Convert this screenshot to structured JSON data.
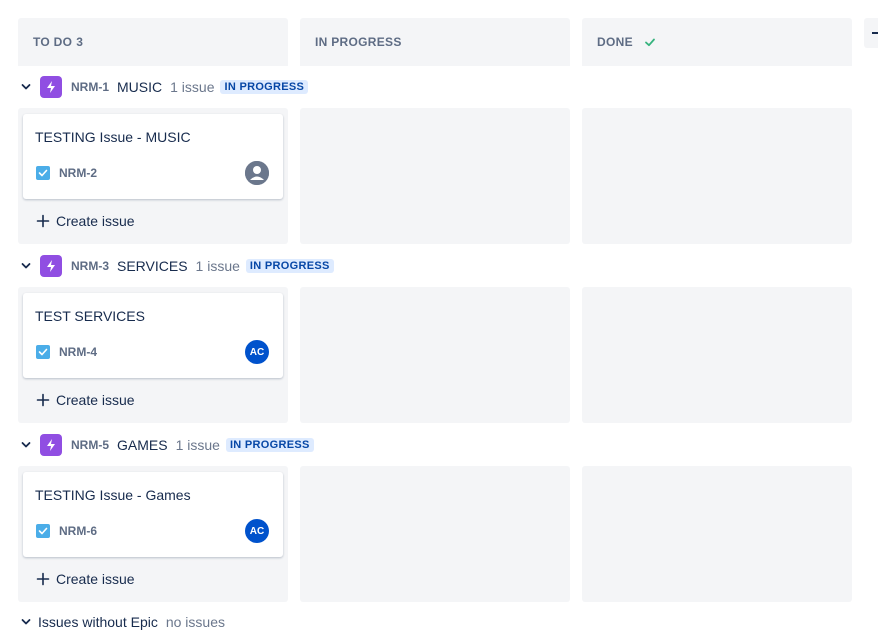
{
  "columns": [
    {
      "label": "TO DO",
      "count": "3"
    },
    {
      "label": "IN PROGRESS",
      "count": ""
    },
    {
      "label": "DONE",
      "count": ""
    }
  ],
  "epics": [
    {
      "key": "NRM-1",
      "name": "MUSIC",
      "issue_count": "1 issue",
      "status": "IN PROGRESS",
      "card": {
        "title": "TESTING Issue - MUSIC",
        "key": "NRM-2",
        "assignee": "",
        "assignee_type": "default-avatar-icon"
      },
      "create_label": "Create issue"
    },
    {
      "key": "NRM-3",
      "name": "SERVICES",
      "issue_count": "1 issue",
      "status": "IN PROGRESS",
      "card": {
        "title": "TEST SERVICES",
        "key": "NRM-4",
        "assignee": "AC",
        "assignee_type": "initials"
      },
      "create_label": "Create issue"
    },
    {
      "key": "NRM-5",
      "name": "GAMES",
      "issue_count": "1 issue",
      "status": "IN PROGRESS",
      "card": {
        "title": "TESTING Issue - Games",
        "key": "NRM-6",
        "assignee": "AC",
        "assignee_type": "initials"
      },
      "create_label": "Create issue"
    }
  ],
  "no_epic": {
    "label": "Issues without Epic",
    "sub": "no issues"
  },
  "colors": {
    "epic": "#904ee2",
    "lozenge_bg": "#deebff",
    "lozenge_text": "#0747a6",
    "avatar": "#0052cc",
    "checkbox": "#4bade8",
    "done_check": "#36b37e",
    "column_bg": "#f4f5f7"
  }
}
